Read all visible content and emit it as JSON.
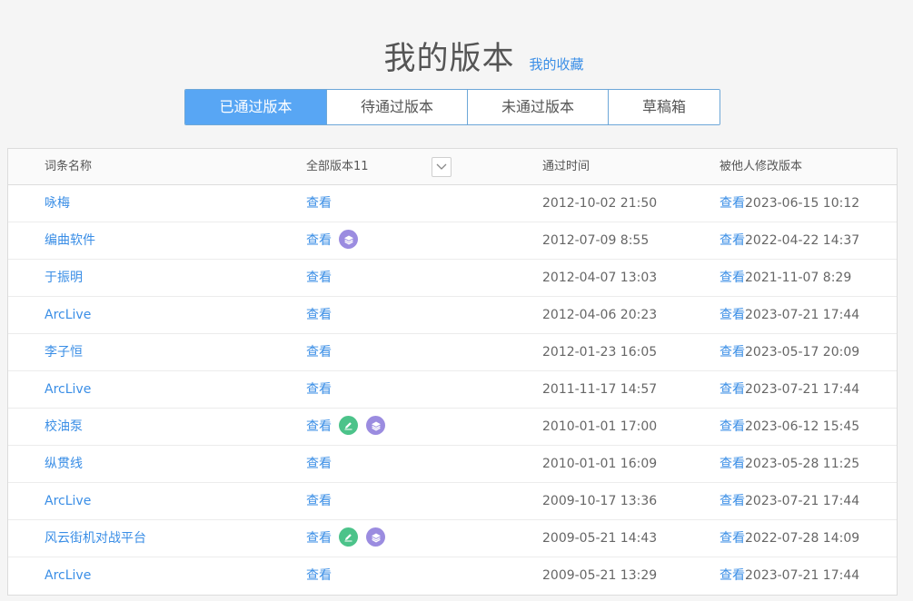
{
  "header": {
    "title": "我的版本",
    "favorites_link": "我的收藏"
  },
  "tabs": [
    {
      "label": "已通过版本",
      "active": true
    },
    {
      "label": "待通过版本",
      "active": false
    },
    {
      "label": "未通过版本",
      "active": false
    },
    {
      "label": "草稿箱",
      "active": false
    }
  ],
  "table": {
    "columns": {
      "name": "词条名称",
      "versions": "全部版本11",
      "passed_time": "通过时间",
      "modified_by_others": "被他人修改版本"
    },
    "view_label": "查看",
    "rows": [
      {
        "name": "咏梅",
        "icons": [],
        "passed_time": "2012-10-02 21:50",
        "modified_time": "2023-06-15 10:12"
      },
      {
        "name": "编曲软件",
        "icons": [
          "layers-icon"
        ],
        "passed_time": "2012-07-09 8:55",
        "modified_time": "2022-04-22 14:37"
      },
      {
        "name": "于振明",
        "icons": [],
        "passed_time": "2012-04-07 13:03",
        "modified_time": "2021-11-07 8:29"
      },
      {
        "name": "ArcLive",
        "icons": [],
        "passed_time": "2012-04-06 20:23",
        "modified_time": "2023-07-21 17:44"
      },
      {
        "name": "李子恒",
        "icons": [],
        "passed_time": "2012-01-23 16:05",
        "modified_time": "2023-05-17 20:09"
      },
      {
        "name": "ArcLive",
        "icons": [],
        "passed_time": "2011-11-17 14:57",
        "modified_time": "2023-07-21 17:44"
      },
      {
        "name": "校油泵",
        "icons": [
          "edit-icon",
          "layers-icon"
        ],
        "passed_time": "2010-01-01 17:00",
        "modified_time": "2023-06-12 15:45"
      },
      {
        "name": "纵贯线",
        "icons": [],
        "passed_time": "2010-01-01 16:09",
        "modified_time": "2023-05-28 11:25"
      },
      {
        "name": "ArcLive",
        "icons": [],
        "passed_time": "2009-10-17 13:36",
        "modified_time": "2023-07-21 17:44"
      },
      {
        "name": "风云街机对战平台",
        "icons": [
          "edit-icon",
          "layers-icon"
        ],
        "passed_time": "2009-05-21 14:43",
        "modified_time": "2022-07-28 14:09"
      },
      {
        "name": "ArcLive",
        "icons": [],
        "passed_time": "2009-05-21 13:29",
        "modified_time": "2023-07-21 17:44"
      }
    ]
  },
  "colors": {
    "accent": "#3a8ee6",
    "active_tab": "#58a6f4",
    "edit_badge": "#4cc38a",
    "layers_badge": "#9b8ce0"
  }
}
